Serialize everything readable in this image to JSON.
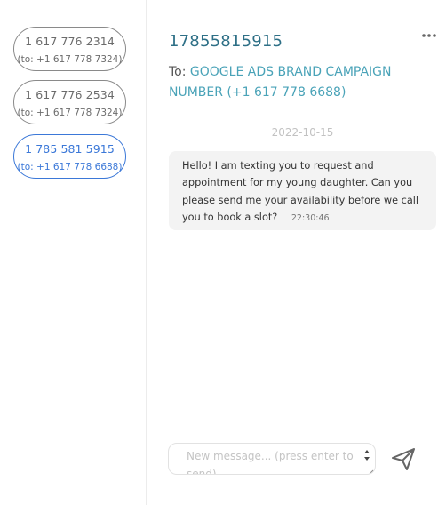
{
  "conversations": [
    {
      "number": "1 617 776 2314",
      "to": "(to: +1 617 778 7324)",
      "active": false
    },
    {
      "number": "1 617 776 2534",
      "to": "(to: +1 617 778 7324)",
      "active": false
    },
    {
      "number": "1 785 581 5915",
      "to": "(to: +1 617 778 6688)",
      "active": true
    }
  ],
  "header": {
    "number": "17855815915",
    "to_label": "To:",
    "to_value": "GOOGLE ADS BRAND CAMPAIGN NUMBER (+1 617 778 6688)",
    "more_icon": "more-horizontal-icon"
  },
  "thread": {
    "date": "2022-10-15",
    "messages": [
      {
        "text": "Hello! I am texting you to request and appointment for my young daughter. Can you please send me your availability before we call you to book a slot?",
        "time": "22:30:46"
      }
    ]
  },
  "composer": {
    "placeholder": "New message... (press enter to send)",
    "value": "",
    "send_icon": "send-icon"
  },
  "colors": {
    "accent_blue": "#3b78d8",
    "header_teal": "#2d6f86",
    "link_teal": "#4aa3b8",
    "bubble_bg": "#f3f3f3"
  }
}
